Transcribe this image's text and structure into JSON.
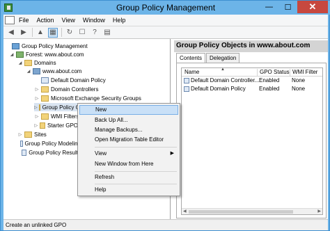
{
  "window": {
    "title": "Group Policy Management",
    "minimize": "—",
    "maximize": "☐",
    "close": "✕"
  },
  "menu": {
    "items": [
      "File",
      "Action",
      "View",
      "Window",
      "Help"
    ]
  },
  "tree": {
    "root": "Group Policy Management",
    "forest": "Forest: www.about.com",
    "domains": "Domains",
    "domain": "www.about.com",
    "default_domain_policy": "Default Domain Policy",
    "domain_controllers": "Domain Controllers",
    "exchange_groups": "Microsoft Exchange Security Groups",
    "gpo_container": "Group Policy Objects",
    "wmi_filters": "WMI Filters",
    "starter_gpos": "Starter GPOs",
    "sites": "Sites",
    "gp_modeling": "Group Policy Modeling",
    "gp_results": "Group Policy Results"
  },
  "right_pane": {
    "header": "Group Policy Objects in www.about.com",
    "tabs": [
      "Contents",
      "Delegation"
    ],
    "columns": [
      "Name",
      "GPO Status",
      "WMI Filter"
    ],
    "rows": [
      {
        "name": "Default Domain Controller...",
        "status": "Enabled",
        "wmi": "None"
      },
      {
        "name": "Default Domain Policy",
        "status": "Enabled",
        "wmi": "None"
      }
    ]
  },
  "context_menu": {
    "new": "New",
    "backup_all": "Back Up All...",
    "manage_backups": "Manage Backups...",
    "migration_table": "Open Migration Table Editor",
    "view": "View",
    "new_window": "New Window from Here",
    "refresh": "Refresh",
    "help": "Help"
  },
  "status": "Create an unlinked GPO"
}
